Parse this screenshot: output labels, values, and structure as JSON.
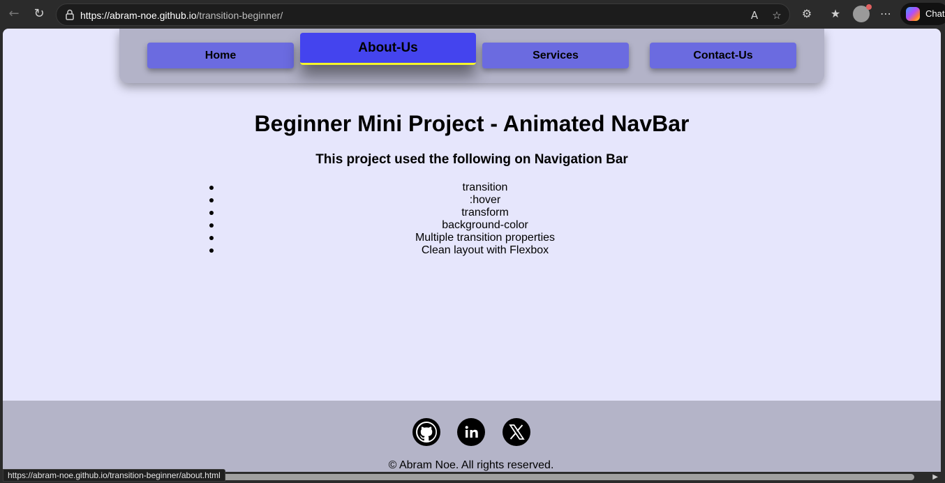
{
  "browser": {
    "url_host": "https://abram-noe.github.io",
    "url_path": "/transition-beginner/",
    "chat_label": "Chat",
    "status_url": "https://abram-noe.github.io/transition-beginner/about.html",
    "icons": [
      "back-icon",
      "reload-icon",
      "lock-icon",
      "read-aloud-icon",
      "favorite-star-icon",
      "extensions-icon",
      "favorites-icon",
      "profile-avatar",
      "more-icon",
      "copilot-icon"
    ]
  },
  "nav": {
    "items": [
      {
        "label": "Home"
      },
      {
        "label": "About-Us"
      },
      {
        "label": "Services"
      },
      {
        "label": "Contact-Us"
      }
    ],
    "active_index": 1,
    "colors": {
      "item": "#6b6be0",
      "active": "#4444ee",
      "underline": "#f5f52a",
      "bar": "#b3b3c8"
    }
  },
  "main": {
    "title": "Beginner Mini Project - Animated NavBar",
    "subtitle": "This project used the following on Navigation Bar",
    "features": [
      "transition",
      ":hover",
      "transform",
      "background-color",
      "Multiple transition properties",
      "Clean layout with Flexbox"
    ],
    "background": "#e6e6fc"
  },
  "footer": {
    "social_icons": [
      "github-icon",
      "linkedin-icon",
      "x-twitter-icon"
    ],
    "copyright": "© Abram Noe. All rights reserved.",
    "background": "#b4b4c8"
  }
}
